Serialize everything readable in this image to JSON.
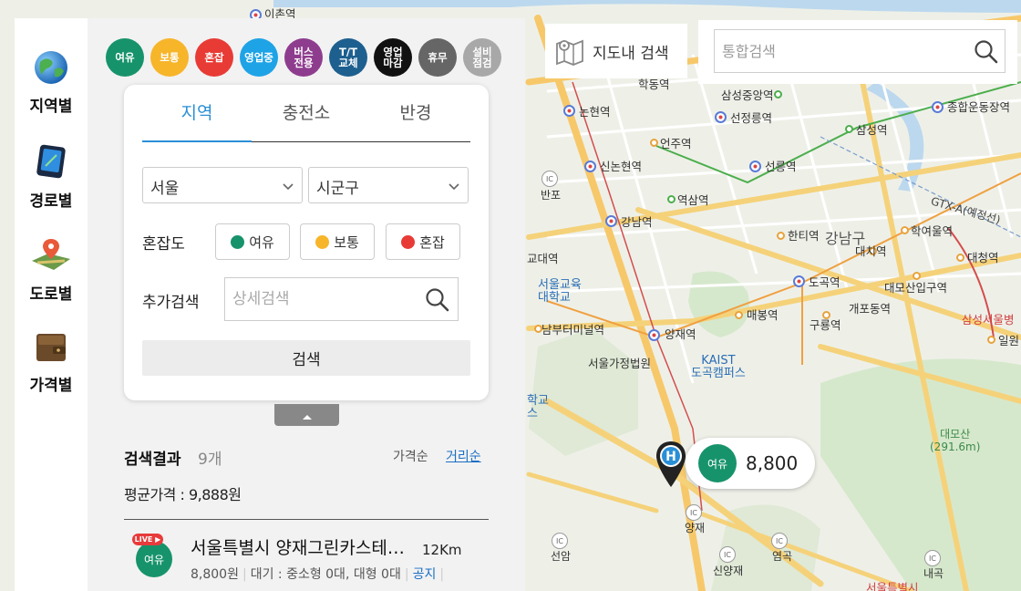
{
  "map": {
    "toolbar": {
      "map_search_label": "지도내 검색",
      "unified_search_placeholder": "통합검색"
    },
    "labels": {
      "top_station": "이촌역",
      "nonhyeon": "논현역",
      "sinnonhyeon": "신논현역",
      "gangnam": "강남역",
      "yangjae": "양재역",
      "samseong_jungang": "삼성중앙역",
      "seonjeongneung": "선정릉역",
      "eonju": "언주역",
      "seolleung": "선릉역",
      "yeoksam": "역삼역",
      "samseong": "삼성역",
      "sports_complex": "종합운동장역",
      "hanti": "한티역",
      "gangnam_gu": "강남구",
      "daechi": "대치역",
      "hagyeoul": "학여울역",
      "daecheong": "대청역",
      "dogok": "도곡역",
      "daemosan_entrance": "대모산입구역",
      "gaepo": "개포동역",
      "guryong": "구룡역",
      "maebong": "매봉역",
      "samsung_hospital": "삼성서울병",
      "irwon": "일원",
      "gtx": "GTX-A(예정선)",
      "edu_univ": "교대역",
      "seoul_edu_univ": "서울교육\n대학교",
      "nambu_terminal": "남부터미널역",
      "seoul_court": "서울가정법원",
      "kaist": "KAIST\n도곡캠퍼스",
      "school": "학교\n스",
      "daemosan": "대모산\n(291.6m)",
      "banpo": "반포",
      "yangjae_ic": "양재",
      "seonam": "선암",
      "sinyangjae": "신양재",
      "yeomgok": "염곡",
      "naegok": "내곡",
      "bottom_hospital": "서울특별시",
      "hakdong": "학동역"
    },
    "marker": {
      "status": "여유",
      "price": "8,800"
    }
  },
  "side_nav": {
    "items": [
      {
        "label": "지역별",
        "icon": "globe-icon"
      },
      {
        "label": "경로별",
        "icon": "gps-device-icon"
      },
      {
        "label": "도로별",
        "icon": "map-pin-icon"
      },
      {
        "label": "가격별",
        "icon": "wallet-icon"
      }
    ]
  },
  "panel": {
    "legend": [
      {
        "label": "여유",
        "color": "#17936b"
      },
      {
        "label": "보통",
        "color": "#f7b52a"
      },
      {
        "label": "혼잡",
        "color": "#e83b35"
      },
      {
        "label": "영업중",
        "color": "#1ea3e6"
      },
      {
        "label": "버스\n전용",
        "color": "#8e3d8e"
      },
      {
        "label": "T/T\n교체",
        "color": "#1d5f8f"
      },
      {
        "label": "영업\n마감",
        "color": "#111111"
      },
      {
        "label": "휴무",
        "color": "#666666"
      },
      {
        "label": "설비\n점검",
        "color": "#a8a8a8"
      }
    ],
    "tabs": [
      "지역",
      "충전소",
      "반경"
    ],
    "active_tab": "지역",
    "region": {
      "province": "서울",
      "district_placeholder": "시군구"
    },
    "congestion": {
      "label": "혼잡도",
      "options": [
        {
          "label": "여유",
          "color": "#17936b"
        },
        {
          "label": "보통",
          "color": "#f7b52a"
        },
        {
          "label": "혼잡",
          "color": "#e83b35"
        }
      ]
    },
    "extra_search": {
      "label": "추가검색",
      "placeholder": "상세검색"
    },
    "search_button": "검색",
    "results": {
      "title": "검색결과",
      "count": "9개",
      "sort_price": "가격순",
      "sort_distance": "거리순",
      "average_price": "평균가격 : 9,888원"
    },
    "result_items": [
      {
        "live": "LIVE ▶",
        "status": "여유",
        "name": "서울특별시 양재그린카스테이션",
        "distance": "12Km",
        "price": "8,800원",
        "wait": "대기 : 중소형 0대, 대형 0대",
        "notice": "공지"
      }
    ]
  }
}
